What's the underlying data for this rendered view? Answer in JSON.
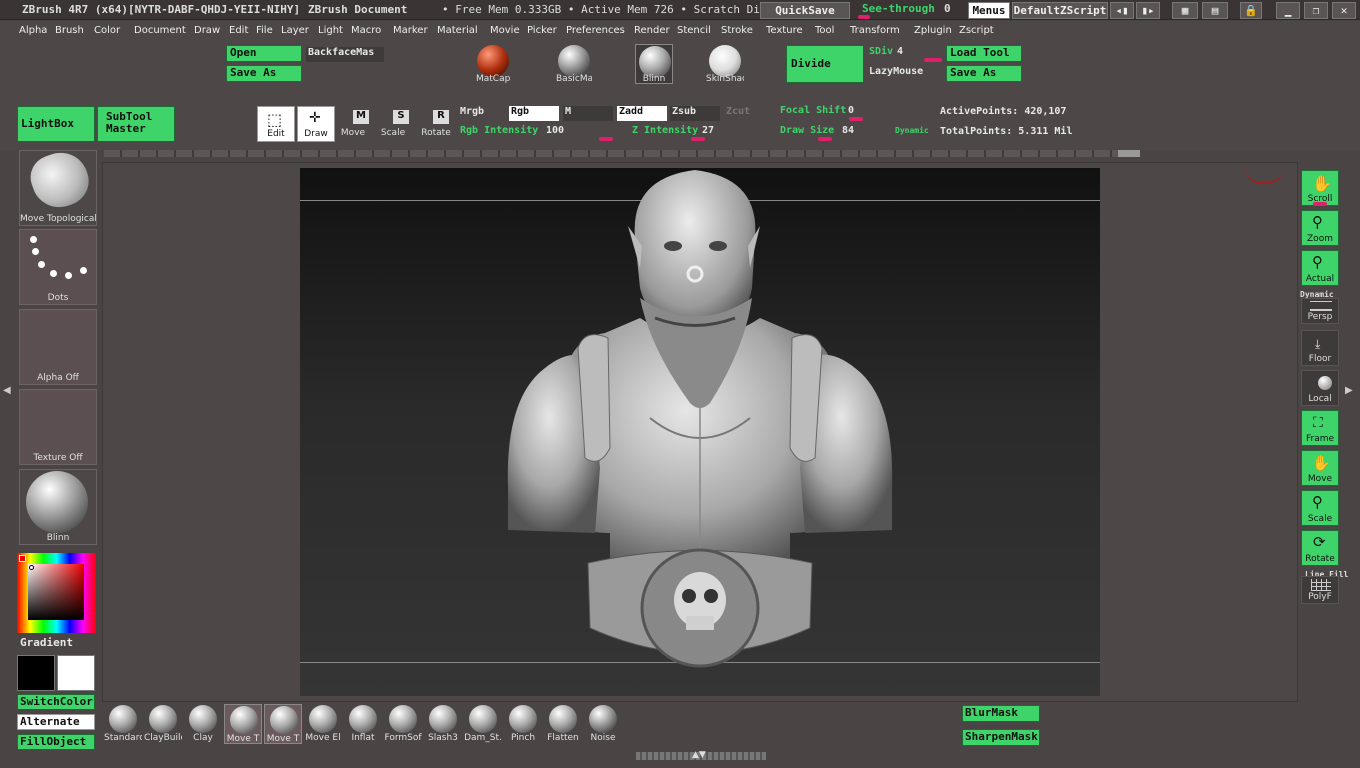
{
  "titlebar": {
    "app": "ZBrush 4R7 (x64)[NYTR-DABF-QHDJ-YEII-NIHY]",
    "doc": "ZBrush Document",
    "mem": "• Free Mem 0.333GB • Active Mem 726 • Scratch Di",
    "quicksave": "QuickSave",
    "seethrough": "See-through",
    "seethrough_val": "0",
    "menus": "Menus",
    "script": "DefaultZScript"
  },
  "menubar": [
    "Alpha",
    "Brush",
    "Color",
    "Document",
    "Draw",
    "Edit",
    "File",
    "Layer",
    "Light",
    "Macro",
    "Marker",
    "Material",
    "Movie",
    "Picker",
    "Preferences",
    "Render",
    "Stencil",
    "Stroke",
    "Texture",
    "Tool",
    "Transform",
    "Zplugin",
    "Zscript"
  ],
  "shelf": {
    "open": "Open",
    "saveas": "Save As",
    "backface": "BackfaceMas",
    "materials": [
      "MatCap",
      "BasicMa",
      "Blinn",
      "SkinShac"
    ],
    "divide": "Divide",
    "sdiv_label": "SDiv",
    "sdiv_val": "4",
    "lazymouse": "LazyMouse",
    "loadtool": "Load Tool",
    "saveas2": "Save As",
    "lightbox": "LightBox",
    "subtool1": "SubTool",
    "subtool2": "Master",
    "tools": [
      "Edit",
      "Draw",
      "Move",
      "Scale",
      "Rotate"
    ],
    "mrgb": "Mrgb",
    "rgb": "Rgb",
    "m": "M",
    "zadd": "Zadd",
    "zsub": "Zsub",
    "zcut": "Zcut",
    "rgb_int_label": "Rgb Intensity",
    "rgb_int_val": "100",
    "z_int_label": "Z Intensity",
    "z_int_val": "27",
    "focal_label": "Focal Shift",
    "focal_val": "0",
    "drawsize_label": "Draw Size",
    "drawsize_val": "84",
    "dynamic": "Dynamic",
    "active_label": "ActivePoints:",
    "active_val": "420,107",
    "total_label": "TotalPoints:",
    "total_val": "5.311 Mil"
  },
  "left": {
    "brush_label": "Move Topological",
    "stroke_label": "Dots",
    "alpha_label": "Alpha Off",
    "texture_label": "Texture Off",
    "material_label": "Blinn",
    "gradient": "Gradient",
    "switchcolor": "SwitchColor",
    "alternate": "Alternate",
    "fillobject": "FillObject"
  },
  "right": [
    "Scroll",
    "Zoom",
    "Actual",
    "Persp",
    "Floor",
    "Local",
    "Frame",
    "Move",
    "Scale",
    "Rotate",
    "PolyF"
  ],
  "right_extra": {
    "aahalf": "Dynamic",
    "linefill": "Line Fill"
  },
  "brushes": [
    "Standarc",
    "ClayBuilc",
    "Clay",
    "Move T",
    "Move T",
    "Move El",
    "Inflat",
    "FormSof",
    "Slash3",
    "Dam_St.",
    "Pinch",
    "Flatten",
    "Noise"
  ],
  "bottom": {
    "blurmask": "BlurMask",
    "sharpenmask": "SharpenMask"
  },
  "colors": {
    "accent": "#3fd46a",
    "bg": "#4a4544",
    "slider": "#e0206a"
  }
}
